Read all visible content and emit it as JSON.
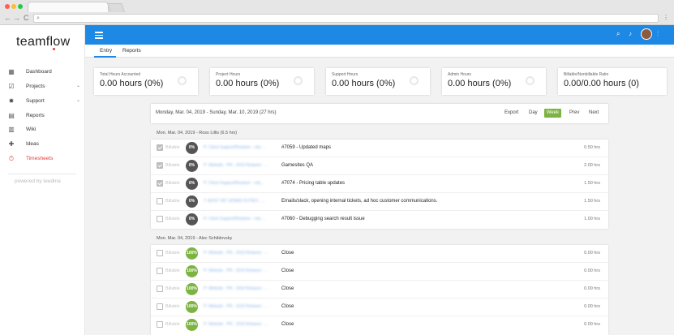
{
  "colors": {
    "brand_blue": "#1e88e5",
    "active_red": "#e53935",
    "week_green": "#7cb342",
    "dark_badge": "#555555",
    "done_green": "#7cb342"
  },
  "browser": {
    "traffic_lights": [
      "#ff5f57",
      "#febc2e",
      "#28c840"
    ],
    "back": "←",
    "forward": "→",
    "reload": "C",
    "search_icon": "search-icon",
    "menu": "⋮"
  },
  "sidebar": {
    "logo": "teamflow",
    "items": [
      {
        "label": "Dashboard",
        "icon": "grid-icon",
        "glyph": "▦",
        "chevron": ""
      },
      {
        "label": "Projects",
        "icon": "check-square-icon",
        "glyph": "☑",
        "chevron": "⌄"
      },
      {
        "label": "Support",
        "icon": "gear-icon",
        "glyph": "✹",
        "chevron": "⌄"
      },
      {
        "label": "Reports",
        "icon": "bar-chart-icon",
        "glyph": "▤",
        "chevron": ""
      },
      {
        "label": "Wiki",
        "icon": "library-icon",
        "glyph": "▥",
        "chevron": ""
      },
      {
        "label": "Ideas",
        "icon": "puzzle-icon",
        "glyph": "✚",
        "chevron": ""
      },
      {
        "label": "Timesheets",
        "icon": "stopwatch-icon",
        "glyph": "⏱",
        "chevron": "",
        "active": true
      }
    ],
    "powered_by": "powered by teedina"
  },
  "topbar": {
    "search_icon": "⌕",
    "bell_icon": "♪",
    "voice_icon": "⫶"
  },
  "subtabs": [
    {
      "label": "Entry",
      "active": true
    },
    {
      "label": "Reports",
      "active": false
    }
  ],
  "cards": [
    {
      "label": "Total Hours Accounted",
      "value": "0.00 hours (0%)"
    },
    {
      "label": "Project Hours",
      "value": "0.00 hours (0%)"
    },
    {
      "label": "Support Hours",
      "value": "0.00 hours (0%)"
    },
    {
      "label": "Admin Hours",
      "value": "0.00 hours (0%)"
    },
    {
      "label": "Billable/Nonbillable Ratio",
      "value": "0.00/0.00 hours (0)"
    }
  ],
  "panel": {
    "range": "Monday, Mar. 04, 2019 - Sunday, Mar. 10, 2019 (27 hrs)",
    "controls": {
      "export": "Export",
      "day": "Day",
      "week": "Week",
      "prev": "Prev",
      "next": "Next"
    }
  },
  "groups": [
    {
      "title": "Mon. Mar. 04, 2019 - Ross Lillis (6.5 hrs)",
      "rows": [
        {
          "checked": true,
          "billable": "Billable",
          "pct": "0%",
          "project": "P: Client Support/Retainer - rely ...",
          "desc": "#7059 - Updated maps",
          "hrs": "0.50 hrs"
        },
        {
          "checked": true,
          "billable": "Billable",
          "pct": "0%",
          "project": "P: Website - PR - 2019 Retainer - ...",
          "desc": "Gamesites QA",
          "hrs": "2.00 hrs"
        },
        {
          "checked": true,
          "billable": "Billable",
          "pct": "0%",
          "project": "P: Client Support/Retainer - rely ...",
          "desc": "#7074 - Pricing table updates",
          "hrs": "1.50 hrs"
        },
        {
          "checked": false,
          "billable": "Billable",
          "pct": "0%",
          "project": "T: AD/ST INT. ADMIN DUTIES - ...",
          "desc": "Emails/slack, opening internal tickets, ad hoc customer communications.",
          "hrs": "1.50 hrs"
        },
        {
          "checked": false,
          "billable": "Billable",
          "pct": "0%",
          "project": "P: Client Support/Retainer - rely ...",
          "desc": "#7060 - Debugging search result issue",
          "hrs": "1.00 hrs"
        }
      ]
    },
    {
      "title": "Mon. Mar. 04, 2019 - Alec Schiblovsky",
      "rows": [
        {
          "checked": false,
          "billable": "Billable",
          "pct": "100%",
          "project": "P: Website - PR - 2019 Retainer - ...",
          "desc": "Close",
          "hrs": "0.00 hrs"
        },
        {
          "checked": false,
          "billable": "Billable",
          "pct": "100%",
          "project": "P: Website - PR - 2019 Retainer - ...",
          "desc": "Close",
          "hrs": "0.00 hrs"
        },
        {
          "checked": false,
          "billable": "Billable",
          "pct": "100%",
          "project": "P: Website - PR - 2019 Retainer - ...",
          "desc": "Close",
          "hrs": "0.00 hrs"
        },
        {
          "checked": false,
          "billable": "Billable",
          "pct": "100%",
          "project": "P: Website - PR - 2019 Retainer - ...",
          "desc": "Close",
          "hrs": "0.00 hrs"
        },
        {
          "checked": false,
          "billable": "Billable",
          "pct": "100%",
          "project": "P: Website - PR - 2019 Retainer - ...",
          "desc": "Close",
          "hrs": "0.00 hrs"
        }
      ]
    }
  ]
}
